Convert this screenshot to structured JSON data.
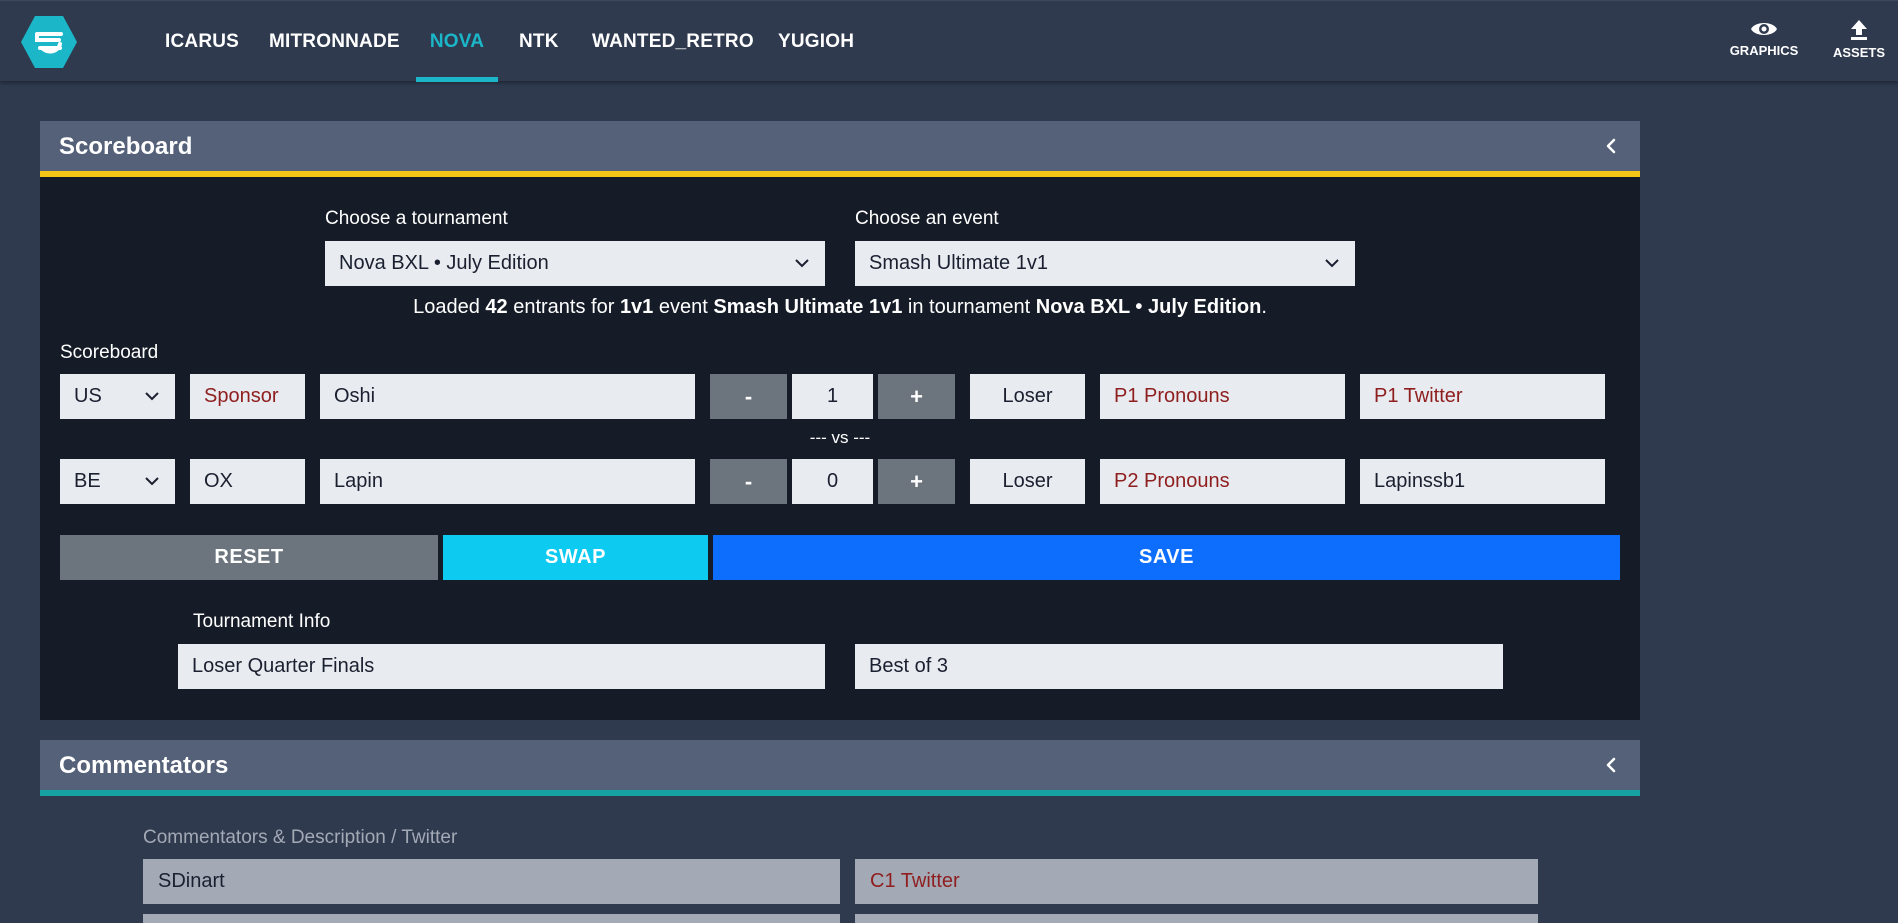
{
  "nav": {
    "tabs": [
      {
        "label": "ICARUS"
      },
      {
        "label": "MITRONNADE"
      },
      {
        "label": "NOVA",
        "active": true
      },
      {
        "label": "NTK"
      },
      {
        "label": "WANTED_RETRO"
      },
      {
        "label": "YUGIOH"
      }
    ],
    "actions": [
      {
        "label": "GRAPHICS",
        "icon": "eye-icon"
      },
      {
        "label": "ASSETS",
        "icon": "upload-icon"
      }
    ]
  },
  "scoreboard": {
    "title": "Scoreboard",
    "tournament_label": "Choose a tournament",
    "tournament_value": "Nova BXL • July Edition",
    "event_label": "Choose an event",
    "event_value": "Smash Ultimate 1v1",
    "loaded": {
      "prefix": "Loaded ",
      "count": "42",
      "mid1": " entrants for ",
      "type": "1v1",
      "mid2": " event ",
      "event": "Smash Ultimate 1v1",
      "mid3": " in tournament ",
      "tournament": "Nova BXL • July Edition",
      "suffix": "."
    },
    "section_label": "Scoreboard",
    "vs_text": "--- vs ---",
    "p1": {
      "country": "US",
      "sponsor_placeholder": "Sponsor",
      "name": "Oshi",
      "minus": "-",
      "score": "1",
      "plus": "+",
      "status": "Loser",
      "pronouns_placeholder": "P1 Pronouns",
      "twitter_placeholder": "P1 Twitter"
    },
    "p2": {
      "country": "BE",
      "sponsor": "OX",
      "name": "Lapin",
      "minus": "-",
      "score": "0",
      "plus": "+",
      "status": "Loser",
      "pronouns_placeholder": "P2 Pronouns",
      "twitter": "Lapinssb1"
    },
    "buttons": {
      "reset": "RESET",
      "swap": "SWAP",
      "save": "SAVE"
    },
    "tournament_info_label": "Tournament Info",
    "round": "Loser Quarter Finals",
    "format": "Best of 3"
  },
  "commentators": {
    "title": "Commentators",
    "label": "Commentators & Description / Twitter",
    "c1_name": "SDinart",
    "c1_twitter_placeholder": "C1 Twitter"
  },
  "colors": {
    "accent": "#1bb7c8",
    "scoreboard_rule": "#f5c518",
    "commentators_rule": "#17a2a2",
    "reset": "#6c757d",
    "swap": "#0dcaf0",
    "save": "#0d6efd"
  }
}
